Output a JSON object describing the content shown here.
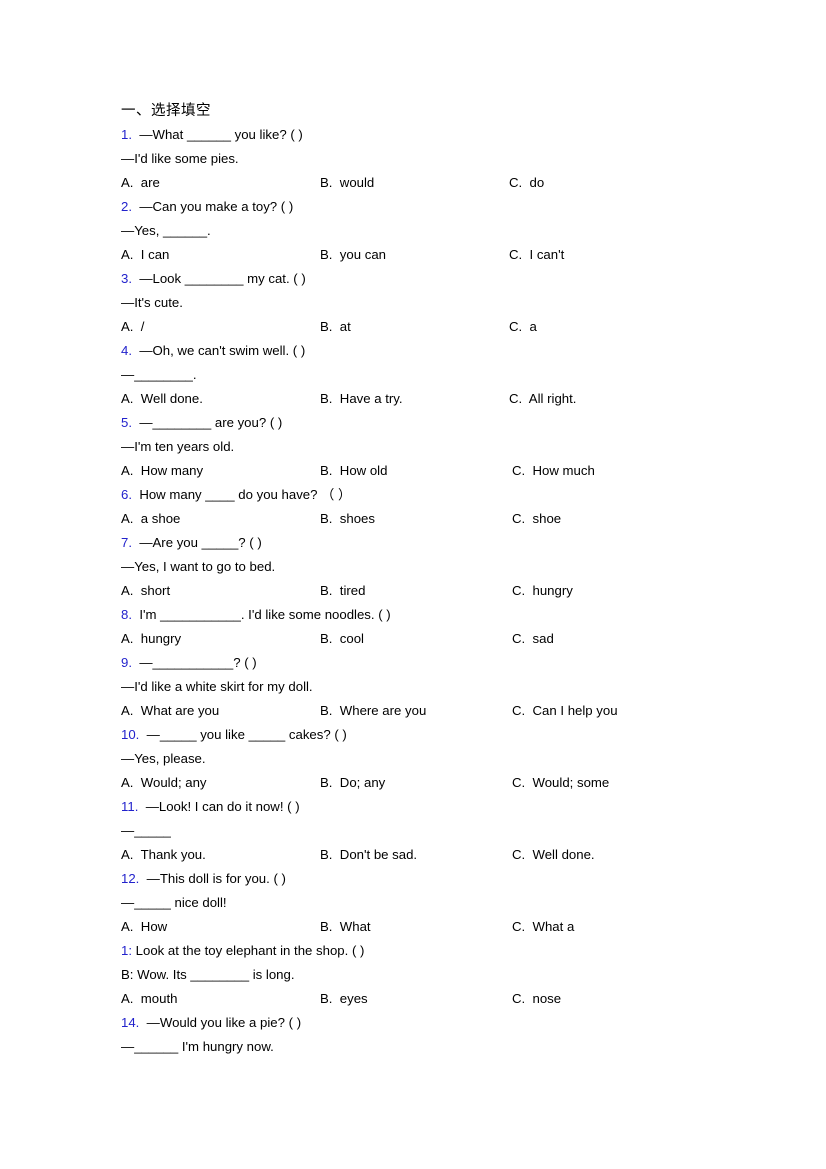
{
  "document": {
    "section_heading": "一、选择填空",
    "questions": [
      {
        "number": "1.",
        "number_color": "#2222cc",
        "stem": "—What ______ you like? (  )",
        "dialog": "—I'd like some pies.",
        "options": [
          {
            "letter": "A.",
            "text": "are"
          },
          {
            "letter": "B.",
            "text": "would"
          },
          {
            "letter": "C.",
            "text": "do"
          }
        ]
      },
      {
        "number": "2.",
        "number_color": "#2222cc",
        "stem": "—Can you make a toy? (  )",
        "dialog": "—Yes, ______.",
        "options": [
          {
            "letter": "A.",
            "text": "I can"
          },
          {
            "letter": "B.",
            "text": "you can"
          },
          {
            "letter": "C.",
            "text": "I can't"
          }
        ]
      },
      {
        "number": "3.",
        "number_color": "#2222cc",
        "stem": "—Look ________ my cat. (   )",
        "dialog": "—It's cute.",
        "options": [
          {
            "letter": "A.",
            "text": "/"
          },
          {
            "letter": "B.",
            "text": "at"
          },
          {
            "letter": "C.",
            "text": "a"
          }
        ]
      },
      {
        "number": "4.",
        "number_color": "#2222cc",
        "stem": "—Oh, we can't swim well. (   )",
        "dialog": "—________.",
        "options": [
          {
            "letter": "A.",
            "text": "Well done."
          },
          {
            "letter": "B.",
            "text": "Have a try."
          },
          {
            "letter": "C.",
            "text": "All right."
          }
        ]
      },
      {
        "number": "5.",
        "number_color": "#2222cc",
        "stem": "—________ are you? (  )",
        "dialog": "—I'm ten years old.",
        "options": [
          {
            "letter": "A.",
            "text": "How many"
          },
          {
            "letter": "B.",
            "text": "How old"
          },
          {
            "letter": "C.",
            "text": "How much"
          }
        ]
      },
      {
        "number": "6.",
        "number_color": "#2222cc",
        "stem": "How many ____ do you have? （ ）",
        "dialog": null,
        "options": [
          {
            "letter": "A.",
            "text": "a shoe"
          },
          {
            "letter": "B.",
            "text": "shoes"
          },
          {
            "letter": "C.",
            "text": "shoe"
          }
        ]
      },
      {
        "number": "7.",
        "number_color": "#2222cc",
        "stem": "—Are you _____? (  )",
        "dialog": "—Yes, I want to go to bed.",
        "options": [
          {
            "letter": "A.",
            "text": "short"
          },
          {
            "letter": "B.",
            "text": "tired"
          },
          {
            "letter": "C.",
            "text": "hungry"
          }
        ]
      },
      {
        "number": "8.",
        "number_color": "#2222cc",
        "stem": "I'm ___________. I'd like some noodles. (  )",
        "dialog": null,
        "options": [
          {
            "letter": "A.",
            "text": "hungry"
          },
          {
            "letter": "B.",
            "text": "cool"
          },
          {
            "letter": "C.",
            "text": "sad"
          }
        ]
      },
      {
        "number": "9.",
        "number_color": "#2222cc",
        "stem": "—___________? (  )",
        "dialog": "—I'd like a white skirt for my doll.",
        "options": [
          {
            "letter": "A.",
            "text": "What are you"
          },
          {
            "letter": "B.",
            "text": "Where are you"
          },
          {
            "letter": "C.",
            "text": "Can I help you"
          }
        ]
      },
      {
        "number": "10.",
        "number_color": "#2222cc",
        "stem": "—_____ you like _____ cakes? (  )",
        "dialog": "—Yes, please.",
        "options": [
          {
            "letter": "A.",
            "text": "Would; any"
          },
          {
            "letter": "B.",
            "text": "Do; any"
          },
          {
            "letter": "C.",
            "text": "Would; some"
          }
        ]
      },
      {
        "number": "11.",
        "number_color": "#2222cc",
        "stem": "—Look! I can do it now! (  )",
        "dialog": "—_____",
        "options": [
          {
            "letter": "A.",
            "text": "Thank you."
          },
          {
            "letter": "B.",
            "text": "Don't be sad."
          },
          {
            "letter": "C.",
            "text": "Well done."
          }
        ]
      },
      {
        "number": "12.",
        "number_color": "#2222cc",
        "stem": "—This doll is for you. (  )",
        "dialog": "—_____ nice doll!",
        "options": [
          {
            "letter": "A.",
            "text": "How"
          },
          {
            "letter": "B.",
            "text": "What"
          },
          {
            "letter": "C.",
            "text": "What a"
          }
        ]
      },
      {
        "number": "1:",
        "number_color": "#2222cc",
        "stem": "Look at the toy elephant in the shop. (   )",
        "dialog": "B: Wow. Its ________ is long.",
        "options": [
          {
            "letter": "A.",
            "text": "mouth"
          },
          {
            "letter": "B.",
            "text": "eyes"
          },
          {
            "letter": "C.",
            "text": "nose"
          }
        ]
      },
      {
        "number": "14.",
        "number_color": "#2222cc",
        "stem": "—Would you like a pie? (  )",
        "dialog": "—______ I'm hungry now.",
        "options": []
      }
    ]
  }
}
